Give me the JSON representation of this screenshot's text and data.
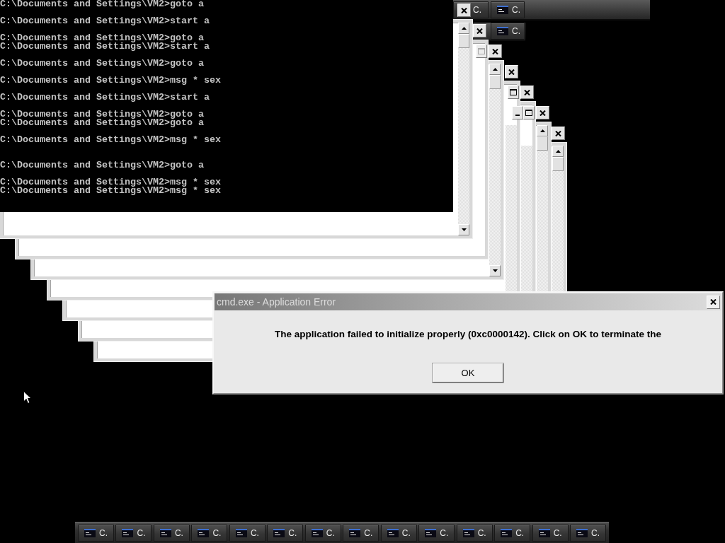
{
  "console": {
    "output": "C:\\Documents and Settings\\VM2>goto a\n\nC:\\Documents and Settings\\VM2>start a\n\nC:\\Documents and Settings\\VM2>goto a\nC:\\Documents and Settings\\VM2>start a\n\nC:\\Documents and Settings\\VM2>goto a\n\nC:\\Documents and Settings\\VM2>msg * sex\n\nC:\\Documents and Settings\\VM2>start a\n\nC:\\Documents and Settings\\VM2>goto a\nC:\\Documents and Settings\\VM2>goto a\n\nC:\\Documents and Settings\\VM2>msg * sex\n\n\nC:\\Documents and Settings\\VM2>goto a\n\nC:\\Documents and Settings\\VM2>msg * sex\nC:\\Documents and Settings\\VM2>msg * sex"
  },
  "taskbar_fragments": [
    {
      "buttons": [
        {
          "kind": "partial",
          "label": "C."
        },
        {
          "kind": "full",
          "label": "C."
        }
      ]
    },
    {
      "buttons": [
        {
          "kind": "full",
          "label": "C."
        }
      ]
    }
  ],
  "windows": [
    {
      "scrollbar": {
        "kind": "full"
      },
      "controls": [
        {
          "kind": "close",
          "disabled": false
        }
      ]
    },
    {
      "controls": [
        {
          "kind": "close",
          "disabled": false
        }
      ]
    },
    {
      "scrollbar": {
        "kind": "full"
      },
      "controls": [
        {
          "kind": "maximize",
          "disabled": true
        },
        {
          "kind": "close",
          "disabled": false
        }
      ]
    },
    {
      "scrollbar": {
        "kind": "track"
      },
      "controls": [
        {
          "kind": "close",
          "disabled": false
        }
      ]
    },
    {
      "scrollbar": {
        "kind": "track"
      },
      "controls": [
        {
          "kind": "maximize",
          "disabled": false
        },
        {
          "kind": "close",
          "disabled": false
        }
      ]
    },
    {
      "scrollbar": {
        "kind": "full"
      },
      "controls": [
        {
          "kind": "minimize",
          "disabled": false
        },
        {
          "kind": "maximize",
          "disabled": false
        },
        {
          "kind": "close",
          "disabled": false
        }
      ]
    },
    {
      "scrollbar": {
        "kind": "full"
      },
      "controls": [
        {
          "kind": "close",
          "disabled": false
        }
      ]
    }
  ],
  "dialog": {
    "title": "cmd.exe - Application Error",
    "message": "The application failed to initialize properly (0xc0000142). Click on OK to terminate the",
    "buttons": [
      "OK"
    ]
  },
  "taskbar": {
    "buttons": [
      {
        "label": "C."
      },
      {
        "label": "C."
      },
      {
        "label": "C."
      },
      {
        "label": "C."
      },
      {
        "label": "C."
      },
      {
        "label": "C."
      },
      {
        "label": "C."
      },
      {
        "label": "C."
      },
      {
        "label": "C."
      },
      {
        "label": "C."
      },
      {
        "label": "C."
      },
      {
        "label": "C."
      },
      {
        "label": "C."
      },
      {
        "label": "C."
      }
    ]
  }
}
